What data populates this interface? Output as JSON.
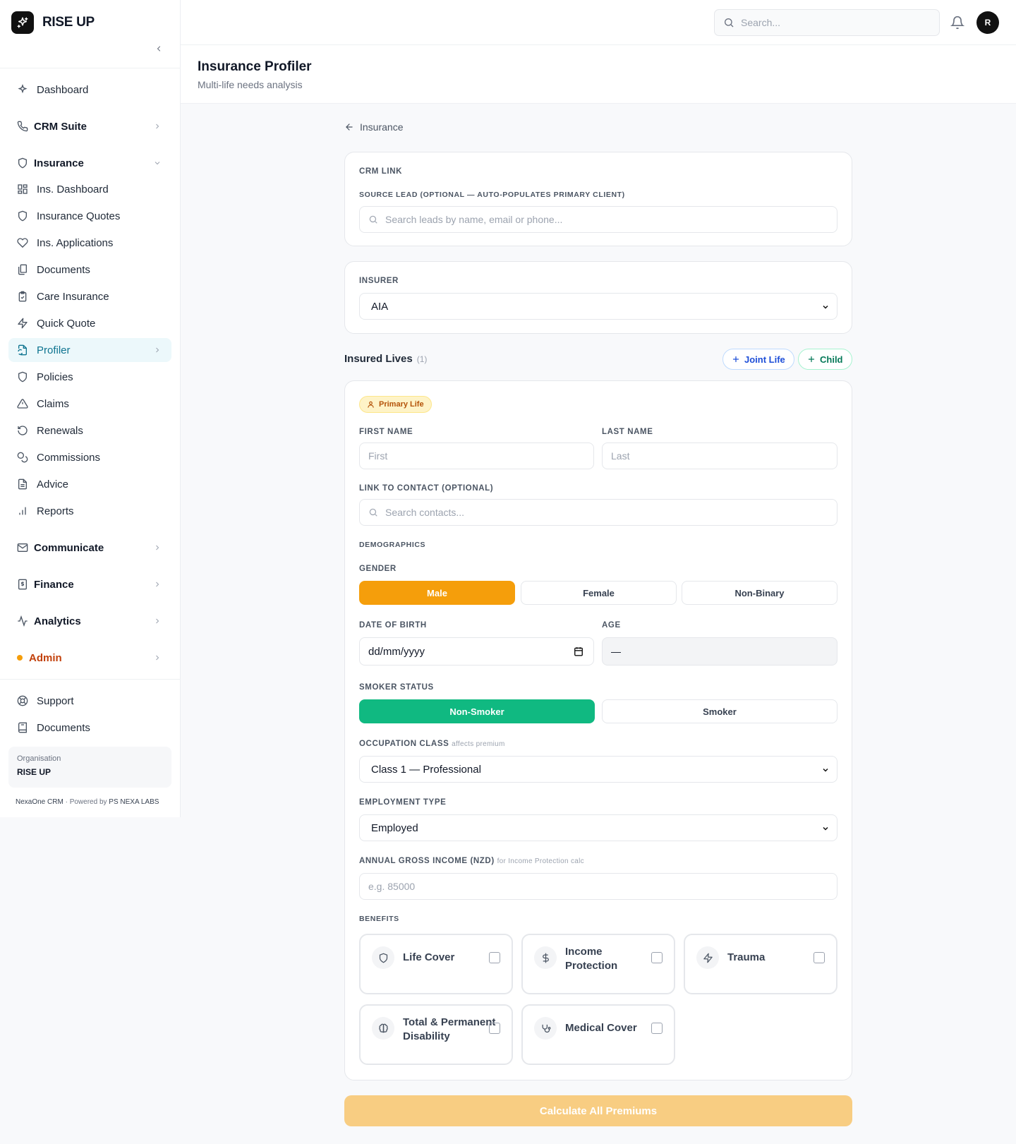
{
  "brand": {
    "name": "RISE UP",
    "logo_icon": "sparkles-icon"
  },
  "topbar": {
    "search_placeholder": "Search...",
    "avatar_initial": "R"
  },
  "sidebar": {
    "dashboard": "Dashboard",
    "crm_suite": "CRM Suite",
    "insurance": "Insurance",
    "insurance_items": [
      "Ins. Dashboard",
      "Insurance Quotes",
      "Ins. Applications",
      "Documents",
      "Care Insurance",
      "Quick Quote",
      "Profiler",
      "Policies",
      "Claims",
      "Renewals",
      "Commissions",
      "Advice",
      "Reports"
    ],
    "communicate": "Communicate",
    "finance": "Finance",
    "analytics": "Analytics",
    "admin": "Admin",
    "support": "Support",
    "documents": "Documents",
    "org_label": "Organisation",
    "org_name": "RISE UP",
    "footer_app": "NexaOne CRM",
    "footer_powered": "· Powered by",
    "footer_company": "PS NEXA LABS",
    "active_item": "Profiler"
  },
  "page": {
    "title": "Insurance Profiler",
    "subtitle": "Multi-life needs analysis",
    "back_label": "Insurance"
  },
  "crm_link": {
    "heading": "CRM LINK",
    "source_label": "SOURCE LEAD (OPTIONAL — AUTO-POPULATES PRIMARY CLIENT)",
    "source_placeholder": "Search leads by name, email or phone..."
  },
  "insurer": {
    "label": "INSURER",
    "value": "AIA"
  },
  "insured_lives": {
    "title": "Insured Lives",
    "count": "(1)",
    "joint_life_label": "Joint Life",
    "child_label": "Child"
  },
  "primary_life": {
    "badge": "Primary Life",
    "first_name_label": "FIRST NAME",
    "first_name_placeholder": "First",
    "last_name_label": "LAST NAME",
    "last_name_placeholder": "Last",
    "contact_label": "LINK TO CONTACT (OPTIONAL)",
    "contact_placeholder": "Search contacts...",
    "demographics_label": "DEMOGRAPHICS",
    "gender_label": "GENDER",
    "gender_options": [
      "Male",
      "Female",
      "Non-Binary"
    ],
    "gender_selected": "Male",
    "dob_label": "DATE OF BIRTH",
    "dob_value": "dd/mm/yyyy",
    "age_label": "AGE",
    "age_value": "—",
    "smoker_label": "SMOKER STATUS",
    "smoker_options": [
      "Non-Smoker",
      "Smoker"
    ],
    "smoker_selected": "Non-Smoker",
    "occupation_label": "OCCUPATION CLASS",
    "occupation_note": "affects premium",
    "occupation_value": "Class 1 — Professional",
    "employment_label": "EMPLOYMENT TYPE",
    "employment_value": "Employed",
    "income_label": "ANNUAL GROSS INCOME (NZD)",
    "income_note": "for Income Protection calc",
    "income_placeholder": "e.g. 85000",
    "benefits_label": "BENEFITS",
    "benefits": [
      {
        "name": "Life Cover",
        "icon": "shield-icon",
        "checked": false
      },
      {
        "name": "Income Protection",
        "icon": "dollar-icon",
        "checked": false
      },
      {
        "name": "Trauma",
        "icon": "zap-icon",
        "checked": false
      },
      {
        "name": "Total & Permanent Disability",
        "icon": "brain-icon",
        "checked": false
      },
      {
        "name": "Medical Cover",
        "icon": "stethoscope-icon",
        "checked": false
      }
    ]
  },
  "calculate_label": "Calculate All Premiums",
  "colors": {
    "accent_amber": "#f59e0b",
    "accent_green": "#10b981",
    "active_teal": "#0e7490"
  }
}
